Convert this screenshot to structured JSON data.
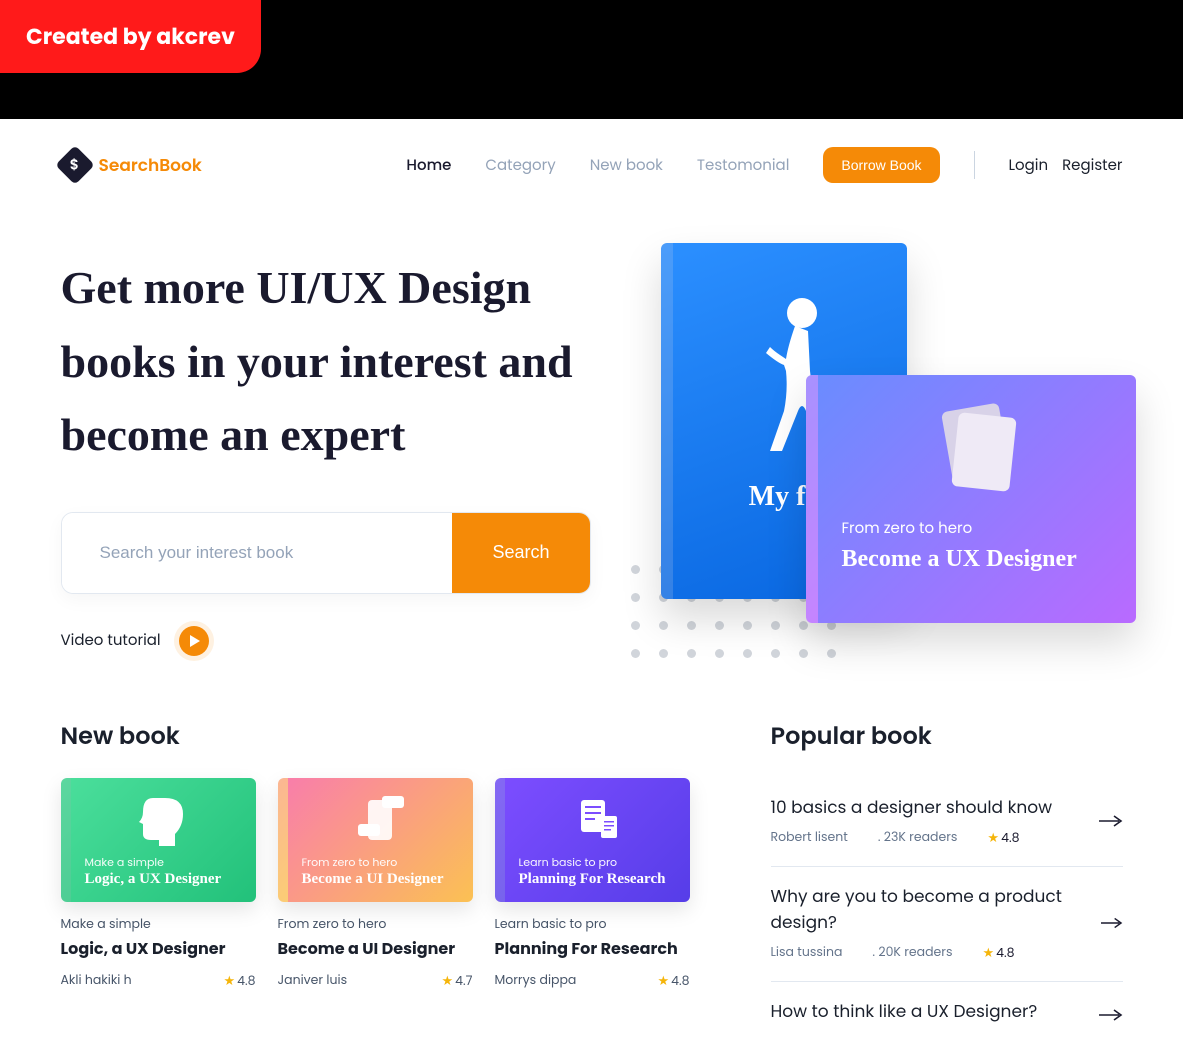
{
  "badge": "Created by akcrev",
  "brand": "SearchBook",
  "nav": {
    "items": [
      "Home",
      "Category",
      "New book",
      "Testomonial"
    ],
    "borrow": "Borrow Book",
    "login": "Login",
    "register": "Register"
  },
  "hero": {
    "title": "Get more UI/UX Design books in your interest and become an expert",
    "search_placeholder": "Search your interest book",
    "search_btn": "Search",
    "video": "Video tutorial",
    "book1_title": "My fut",
    "book2_sub": "From zero to hero",
    "book2_title": "Become a UX Designer"
  },
  "newbook": {
    "heading": "New book",
    "cards": [
      {
        "cover_sub": "Make a simple",
        "cover_title": "Logic, a UX Designer",
        "sub": "Make a simple",
        "title": "Logic, a UX Designer",
        "author": "Akli hakiki h",
        "rating": "4.8"
      },
      {
        "cover_sub": "From zero to hero",
        "cover_title": "Become a UI Designer",
        "sub": "From zero to hero",
        "title": "Become a UI Designer",
        "author": "Janiver luis",
        "rating": "4.7"
      },
      {
        "cover_sub": "Learn basic to pro",
        "cover_title": "Planning For Research",
        "sub": "Learn basic to pro",
        "title": "Planning For Research",
        "author": "Morrys dippa",
        "rating": "4.8"
      }
    ]
  },
  "popular": {
    "heading": "Popular book",
    "items": [
      {
        "title": "10 basics a designer should know",
        "author": "Robert lisent",
        "readers": ". 23K readers",
        "rating": "4.8"
      },
      {
        "title": "Why are you to become a product design?",
        "author": "Lisa tussina",
        "readers": ". 20K readers",
        "rating": "4.8"
      },
      {
        "title": "How to think like a UX Designer?",
        "author": "",
        "readers": "",
        "rating": ""
      }
    ]
  }
}
